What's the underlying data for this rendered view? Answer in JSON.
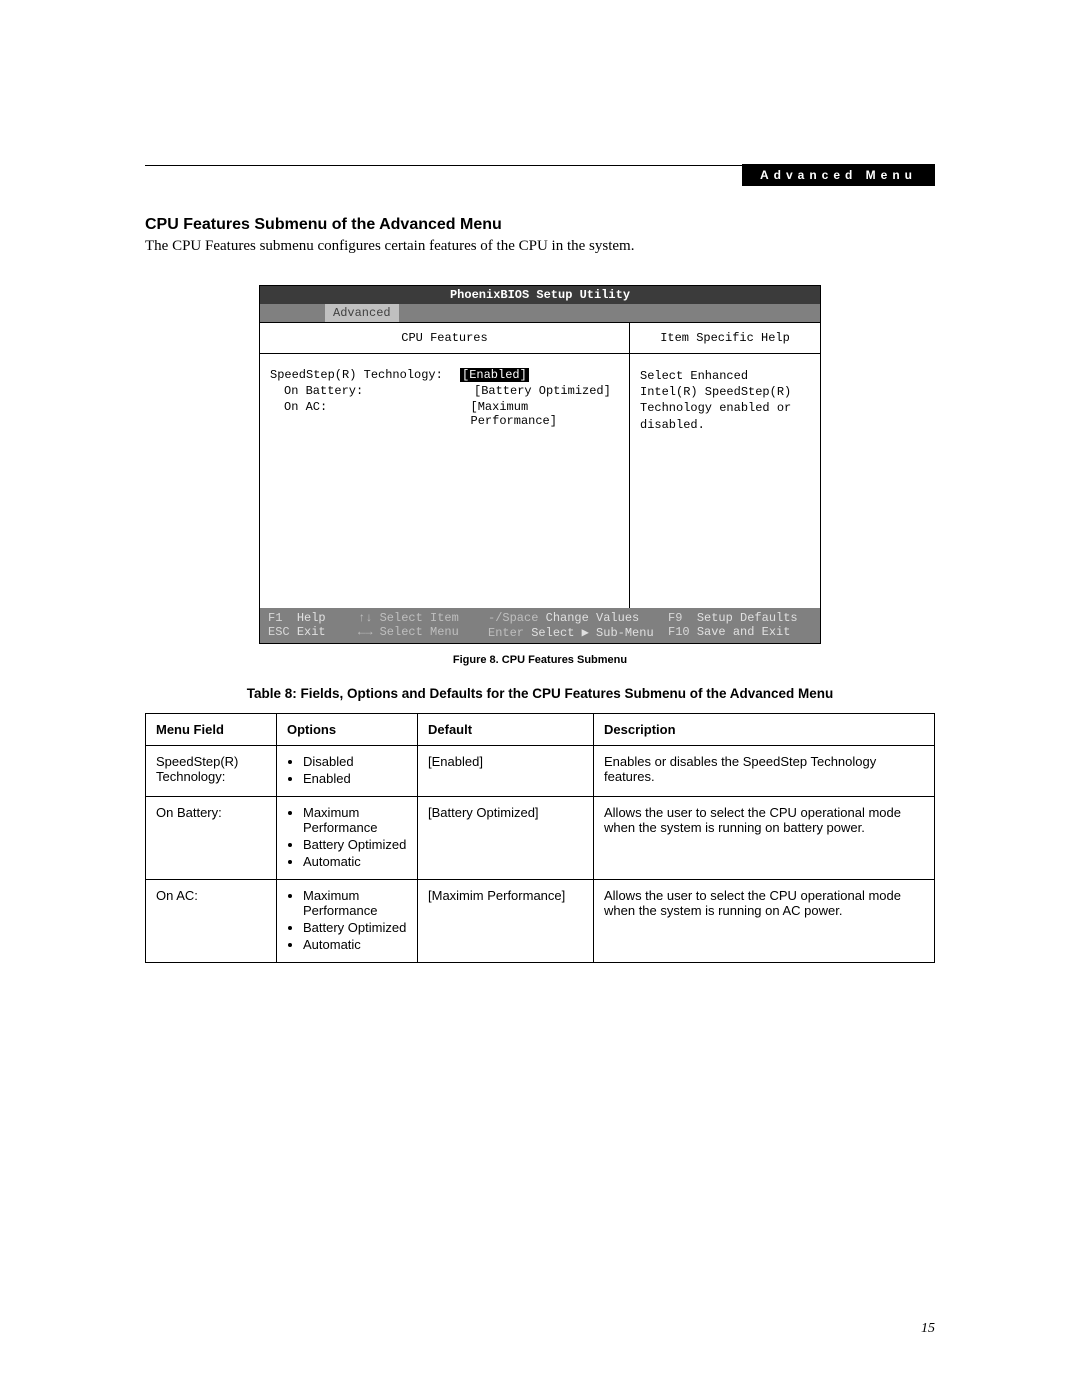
{
  "header": {
    "tab_label": "Advanced Menu"
  },
  "section": {
    "heading": "CPU Features Submenu of the Advanced Menu",
    "intro": "The CPU Features submenu configures certain features of the CPU in the system."
  },
  "bios": {
    "utility_title": "PhoenixBIOS Setup Utility",
    "active_tab": "Advanced",
    "left_header": "CPU Features",
    "right_header": "Item Specific Help",
    "settings": [
      {
        "label": "SpeedStep(R) Technology:",
        "value": "[Enabled]",
        "selected": true,
        "indent": false
      },
      {
        "label": "On Battery:",
        "value": "[Battery Optimized]",
        "selected": false,
        "indent": true
      },
      {
        "label": "On AC:",
        "value": "[Maximum Performance]",
        "selected": false,
        "indent": true
      }
    ],
    "help_text": "Select Enhanced Intel(R) SpeedStep(R) Technology enabled or disabled.",
    "footer": {
      "r1": {
        "k1": "F1",
        "l1": "Help",
        "a2": "↑↓",
        "l2": "Select Item",
        "a3": "-/Space",
        "l3": "Change Values",
        "k4": "F9",
        "l4": "Setup Defaults"
      },
      "r2": {
        "k1": "ESC",
        "l1": "Exit",
        "a2": "←→",
        "l2": "Select Menu",
        "a3": "Enter",
        "l3": "Select ▶ Sub-Menu",
        "k4": "F10",
        "l4": "Save and Exit"
      }
    }
  },
  "figure_caption": "Figure 8.  CPU Features Submenu",
  "table_caption": "Table 8: Fields, Options and Defaults for the CPU Features Submenu of the Advanced Menu",
  "table": {
    "headers": {
      "c1": "Menu Field",
      "c2": "Options",
      "c3": "Default",
      "c4": "Description"
    },
    "rows": [
      {
        "field": "SpeedStep(R) Technology:",
        "options": [
          "Disabled",
          "Enabled"
        ],
        "default": "[Enabled]",
        "desc": "Enables or disables the SpeedStep Technology features."
      },
      {
        "field": "On Battery:",
        "options": [
          "Maximum Performance",
          "Battery Optimized",
          "Automatic"
        ],
        "default": "[Battery Optimized]",
        "desc": "Allows the user to select the CPU operational mode when the system is running on battery power."
      },
      {
        "field": "On AC:",
        "options": [
          "Maximum Performance",
          "Battery Optimized",
          "Automatic"
        ],
        "default": "[Maximim Performance]",
        "desc": "Allows the user to select the CPU operational mode when the system is running on AC power."
      }
    ]
  },
  "page_number": "15"
}
